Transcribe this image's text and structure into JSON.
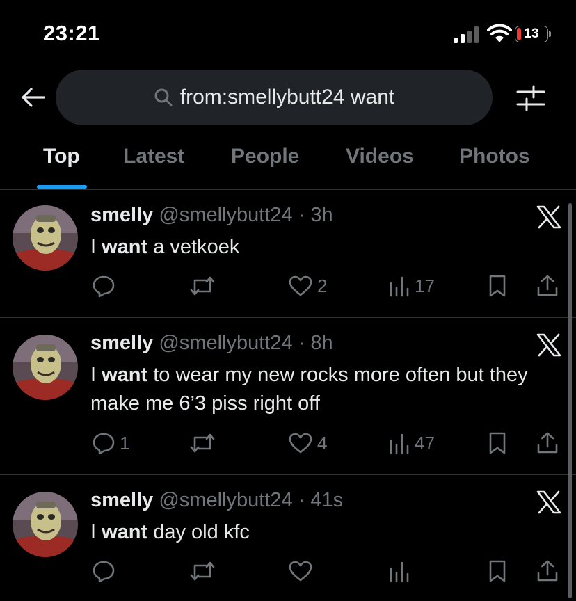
{
  "status_bar": {
    "time": "23:21",
    "battery_level": "13",
    "battery_fraction": 0.13
  },
  "search": {
    "query": "from:smellybutt24 want"
  },
  "tabs": [
    {
      "label": "Top",
      "active": true
    },
    {
      "label": "Latest",
      "active": false
    },
    {
      "label": "People",
      "active": false
    },
    {
      "label": "Videos",
      "active": false
    },
    {
      "label": "Photos",
      "active": false
    }
  ],
  "tweets": [
    {
      "display_name": "smelly",
      "handle": "@smellybutt24",
      "separator": "·",
      "time": "3h",
      "text_bold": "want",
      "text_before": "I ",
      "text_after": " a vetkoek",
      "replies": "",
      "retweets": "",
      "likes": "2",
      "views": "17"
    },
    {
      "display_name": "smelly",
      "handle": "@smellybutt24",
      "separator": "·",
      "time": "8h",
      "text_bold": "want",
      "text_before": "I ",
      "text_after": " to wear my new rocks more often but they make me 6’3 piss right off",
      "replies": "1",
      "retweets": "",
      "likes": "4",
      "views": "47"
    },
    {
      "display_name": "smelly",
      "handle": "@smellybutt24",
      "separator": "·",
      "time": "41s",
      "text_bold": "want",
      "text_before": "I ",
      "text_after": " day old kfc",
      "replies": "",
      "retweets": "",
      "likes": "",
      "views": ""
    }
  ],
  "colors": {
    "accent": "#1d9bf0",
    "background": "#000000",
    "search_bg": "#202327",
    "muted": "#71767b",
    "battery_low": "#e53935"
  }
}
